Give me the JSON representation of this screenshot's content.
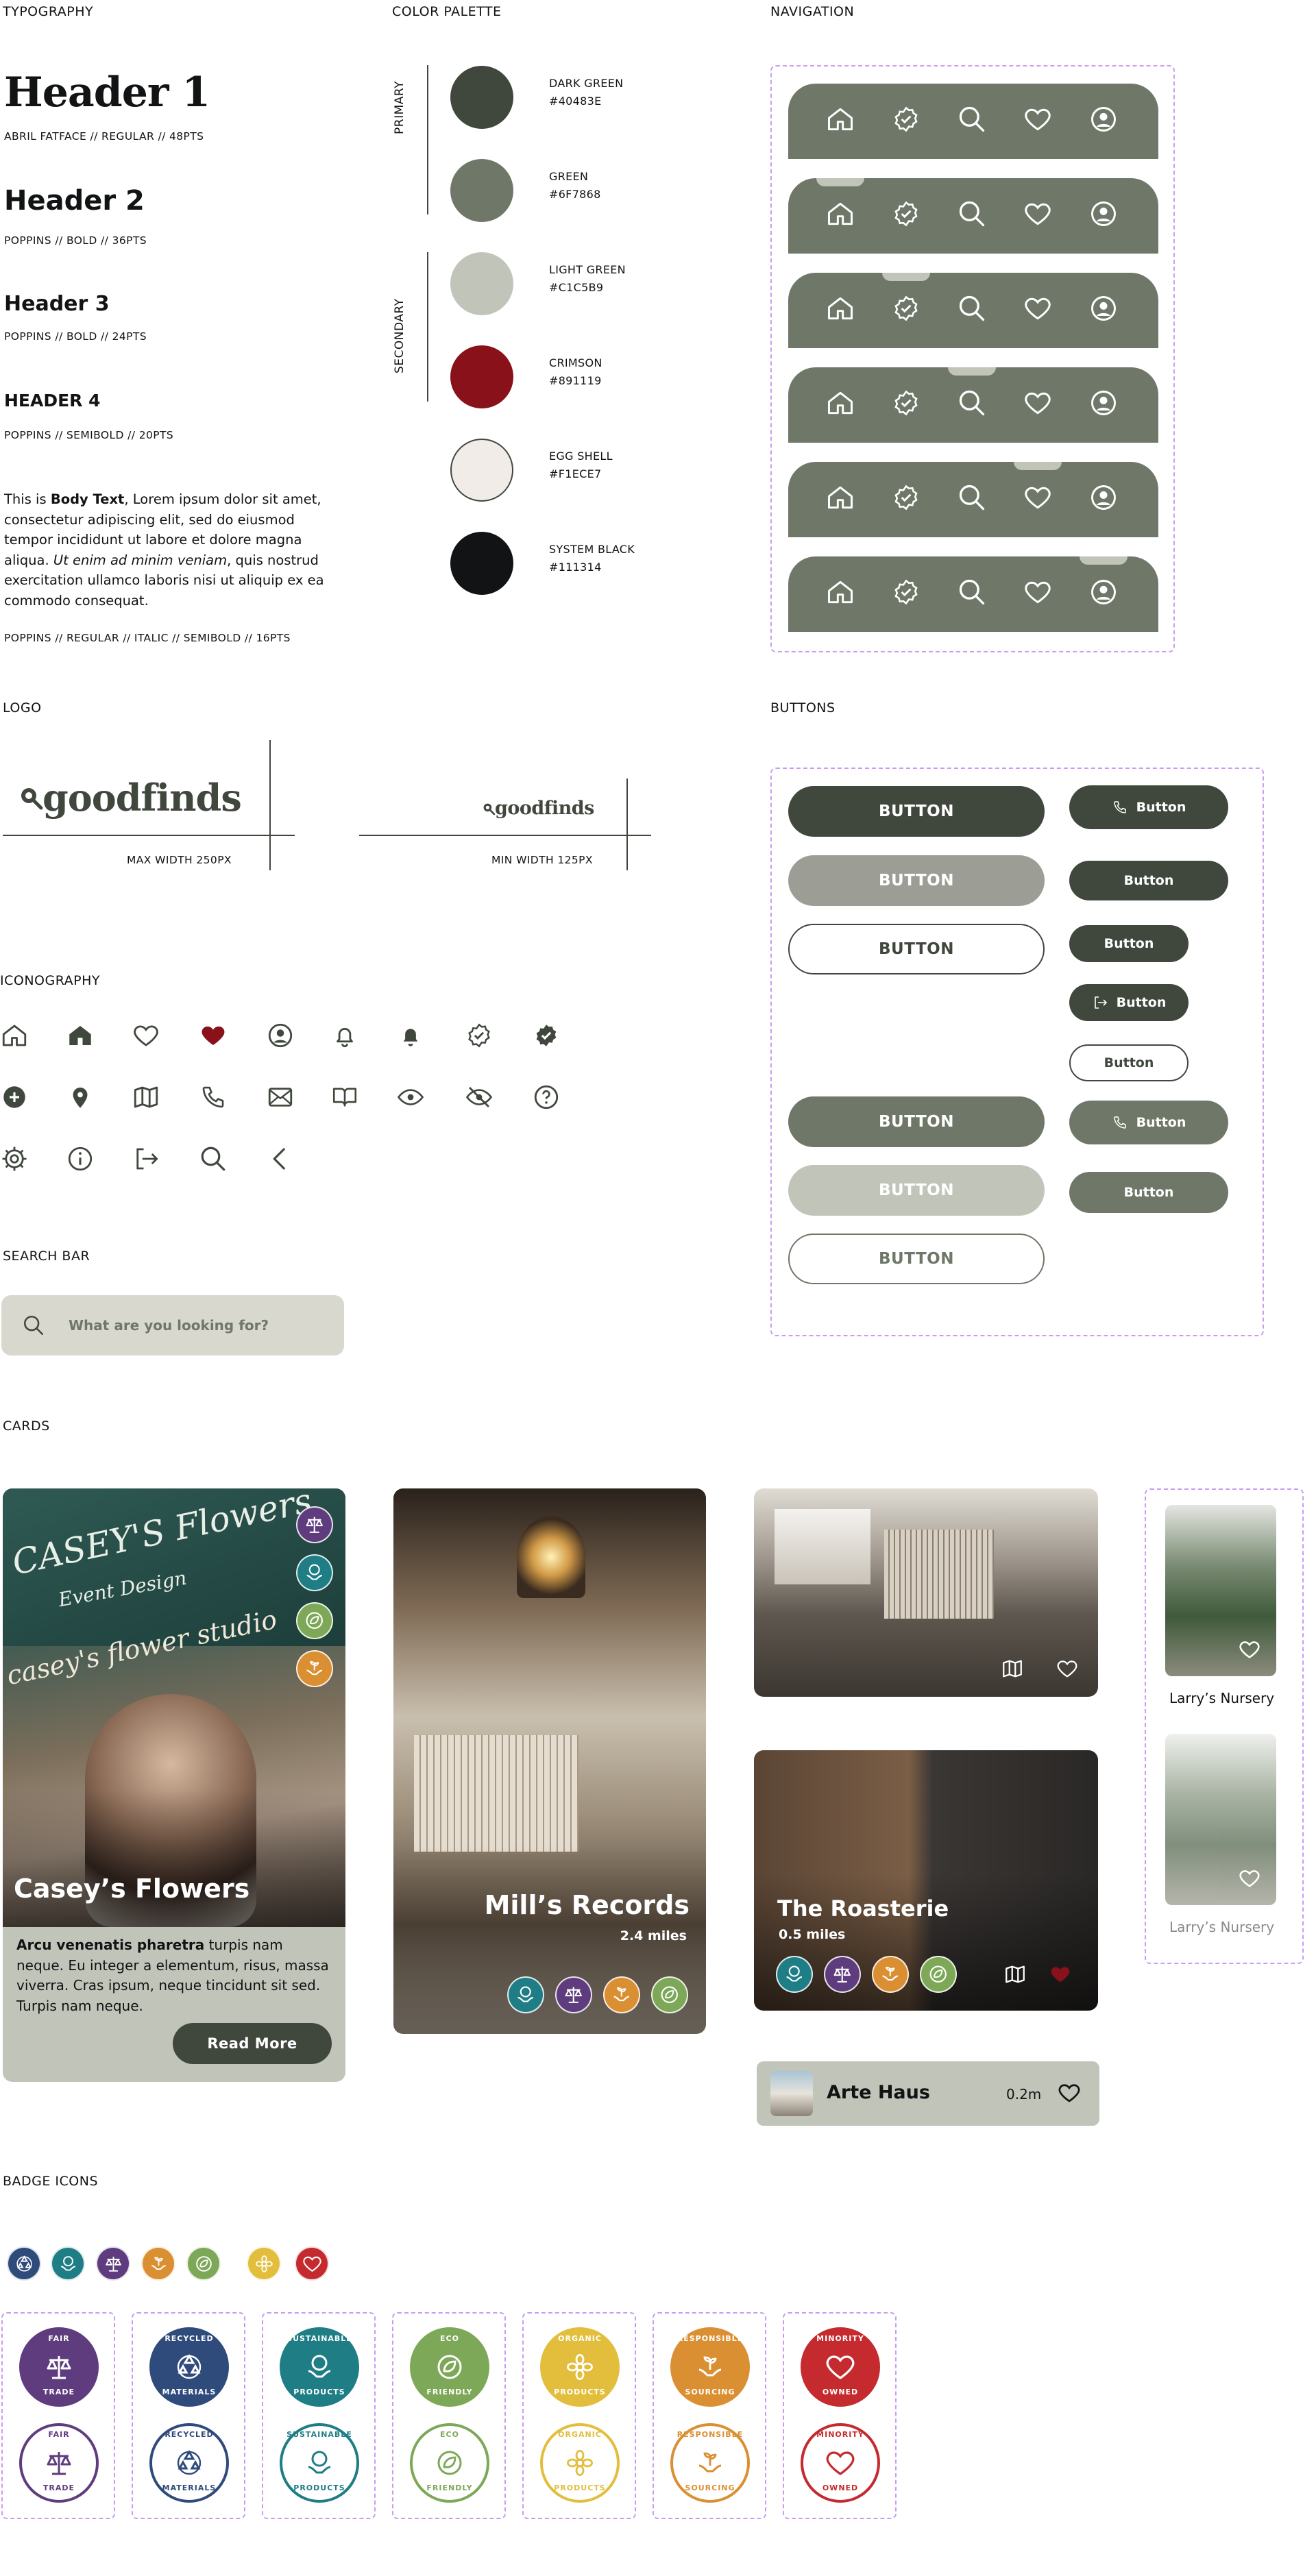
{
  "sections": {
    "typography": "TYPOGRAPHY",
    "color_palette": "COLOR PALETTE",
    "navigation": "NAVIGATION",
    "logo": "LOGO",
    "buttons": "BUTTONS",
    "iconography": "ICONOGRAPHY",
    "search_bar": "SEARCH BAR",
    "cards": "CARDS",
    "badge_icons": "BADGE ICONS"
  },
  "typography": {
    "h1": "Header 1",
    "h1_spec": "ABRIL FATFACE // REGULAR // 48PTS",
    "h2": "Header 2",
    "h2_spec": "POPPINS // BOLD // 36PTS",
    "h3": "Header 3",
    "h3_spec": "POPPINS // BOLD // 24PTS",
    "h4": "HEADER 4",
    "h4_spec": "POPPINS // SEMIBOLD // 20PTS",
    "body_pre": "This is ",
    "body_bold": "Body Text",
    "body_mid": ", Lorem ipsum dolor sit amet, consectetur adipiscing elit, sed do eiusmod tempor incididunt ut labore et dolore magna aliqua. ",
    "body_italic": "Ut enim ad minim veniam",
    "body_post": ", quis nostrud exercitation ullamco laboris nisi ut aliquip ex ea commodo consequat.",
    "body_spec": "POPPINS // REGULAR // ITALIC // SEMIBOLD // 16PTS"
  },
  "palette": {
    "primary_label": "PRIMARY",
    "secondary_label": "SECONDARY",
    "colors": [
      {
        "name": "DARK GREEN",
        "hex": "#40483E"
      },
      {
        "name": "GREEN",
        "hex": "#6F7868"
      },
      {
        "name": "LIGHT GREEN",
        "hex": "#C1C5B9"
      },
      {
        "name": "CRIMSON",
        "hex": "#891119"
      },
      {
        "name": "EGG SHELL",
        "hex": "#F1ECE7"
      },
      {
        "name": "SYSTEM BLACK",
        "hex": "#111314"
      }
    ]
  },
  "logo": {
    "wordmark": "goodfinds",
    "max_label": "MAX WIDTH 250PX",
    "min_label": "MIN WIDTH 125PX"
  },
  "buttons": {
    "large": [
      "BUTTON",
      "BUTTON",
      "BUTTON",
      "BUTTON",
      "BUTTON",
      "BUTTON"
    ],
    "small": [
      "Button",
      "Button",
      "Button",
      "Button",
      "Button",
      "Button",
      "Button"
    ]
  },
  "search": {
    "placeholder": "What are you looking for?"
  },
  "cards": {
    "caseys": {
      "title": "Casey’s Flowers",
      "body_bold": "Arcu venenatis pharetra",
      "body": " turpis nam neque. Eu integer a elementum, risus, massa viverra. Cras ipsum, neque tincidunt sit sed. Turpis nam neque.",
      "cta": "Read More",
      "sign": "CASEY'S  Flowers",
      "sign2": "Event Design",
      "sign3": "casey's flower studio"
    },
    "mills": {
      "title": "Mill’s Records",
      "distance": "2.4 miles"
    },
    "roasterie": {
      "title": "The Roasterie",
      "distance": "0.5 miles"
    },
    "arte": {
      "title": "Arte Haus",
      "distance": "0.2m"
    },
    "larrys_1": "Larry’s Nursery",
    "larrys_2": "Larry’s Nursery"
  },
  "badges": [
    {
      "top": "FAIR",
      "bottom": "TRADE",
      "color": "#5E3C7E",
      "icon": "scales-icon"
    },
    {
      "top": "RECYCLED",
      "bottom": "MATERIALS",
      "color": "#2F4B7C",
      "icon": "recycle-icon"
    },
    {
      "top": "SUSTAINABLE",
      "bottom": "PRODUCTS",
      "color": "#1F7D86",
      "icon": "hands-globe-icon"
    },
    {
      "top": "ECO",
      "bottom": "FRIENDLY",
      "color": "#7DA857",
      "icon": "leaf-globe-icon"
    },
    {
      "top": "ORGANIC",
      "bottom": "PRODUCTS",
      "color": "#E2BE3C",
      "icon": "flower-icon"
    },
    {
      "top": "RESPONSIBLE",
      "bottom": "SOURCING",
      "color": "#DA8F32",
      "icon": "hands-plant-icon"
    },
    {
      "top": "MINORITY",
      "bottom": "OWNED",
      "color": "#C42A2E",
      "icon": "heart-icon"
    }
  ],
  "small_badge_colors": [
    "#2F4B7C",
    "#1F7D86",
    "#5E3C7E",
    "#DA8F32",
    "#7DA857",
    "#E2BE3C",
    "#C42A2E"
  ]
}
